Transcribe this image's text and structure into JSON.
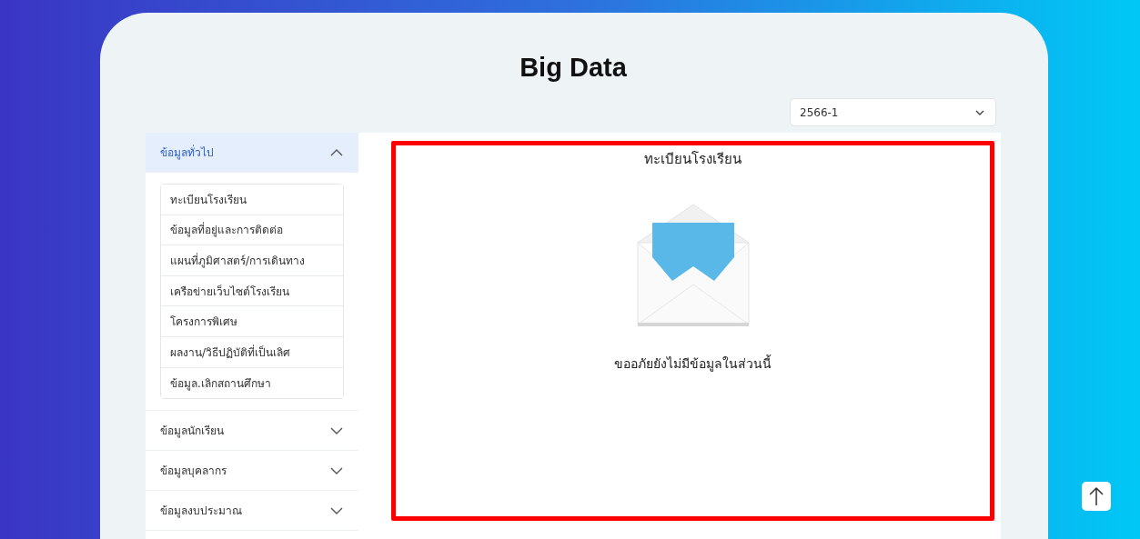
{
  "page": {
    "title": "Big Data"
  },
  "term_select": {
    "value": "2566-1"
  },
  "sidebar": {
    "sections": [
      {
        "label": "ข้อมูลทั่วไป",
        "expanded": true,
        "items": [
          "ทะเบียนโรงเรียน",
          "ข้อมูลที่อยู่และการติดต่อ",
          "แผนที่ภูมิศาสตร์/การเดินทาง",
          "เครือข่ายเว็บไซต์โรงเรียน",
          "โครงการพิเศษ",
          "ผลงาน/วิธีปฏิบัติที่เป็นเลิศ",
          "ข้อมูล.เลิกสถานศึกษา"
        ]
      },
      {
        "label": "ข้อมูลนักเรียน",
        "expanded": false
      },
      {
        "label": "ข้อมูลบุคลากร",
        "expanded": false
      },
      {
        "label": "ข้อมูลงบประมาณ",
        "expanded": false
      }
    ]
  },
  "content": {
    "heading": "ทะเบียนโรงเรียน",
    "message": "ขออภัยยังไม่มีข้อมูลในส่วนนี้"
  }
}
